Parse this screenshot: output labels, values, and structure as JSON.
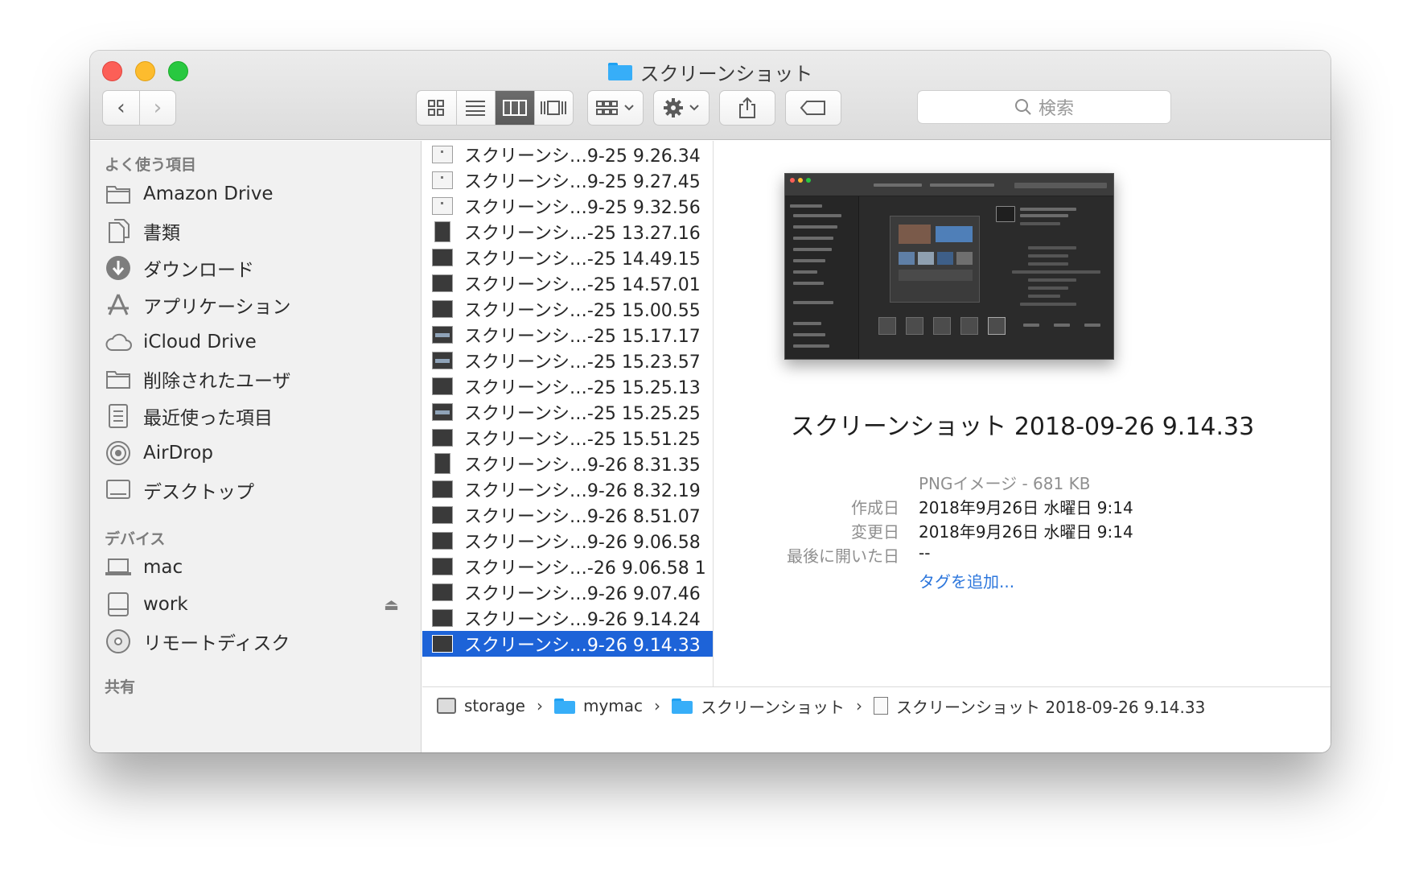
{
  "window": {
    "title": "スクリーンショット"
  },
  "toolbar": {
    "back": "‹",
    "forward": "›",
    "search_placeholder": "検索"
  },
  "sidebar": {
    "sections": {
      "favorites": "よく使う項目",
      "devices": "デバイス",
      "shared": "共有"
    },
    "favorites": [
      {
        "label": "Amazon Drive",
        "icon": "folder-icon"
      },
      {
        "label": "書類",
        "icon": "documents-icon"
      },
      {
        "label": "ダウンロード",
        "icon": "downloads-icon"
      },
      {
        "label": "アプリケーション",
        "icon": "applications-icon"
      },
      {
        "label": "iCloud Drive",
        "icon": "cloud-icon"
      },
      {
        "label": "削除されたユーザ",
        "icon": "folder-icon"
      },
      {
        "label": "最近使った項目",
        "icon": "recents-icon"
      },
      {
        "label": "AirDrop",
        "icon": "airdrop-icon"
      },
      {
        "label": "デスクトップ",
        "icon": "desktop-icon"
      }
    ],
    "devices": [
      {
        "label": "mac",
        "icon": "laptop-icon"
      },
      {
        "label": "work",
        "icon": "drive-icon",
        "eject": "⏏"
      },
      {
        "label": "リモートディスク",
        "icon": "disc-icon"
      }
    ]
  },
  "files": [
    {
      "name": "スクリーンシ…9-25 9.26.34",
      "thumb": "light"
    },
    {
      "name": "スクリーンシ…9-25 9.27.45",
      "thumb": "light"
    },
    {
      "name": "スクリーンシ…9-25 9.32.56",
      "thumb": "light"
    },
    {
      "name": "スクリーンシ…-25 13.27.16",
      "thumb": "tall"
    },
    {
      "name": "スクリーンシ…-25 14.49.15",
      "thumb": "dark"
    },
    {
      "name": "スクリーンシ…-25 14.57.01",
      "thumb": "dark"
    },
    {
      "name": "スクリーンシ…-25 15.00.55",
      "thumb": "dark"
    },
    {
      "name": "スクリーンシ…-25 15.17.17",
      "thumb": "bar"
    },
    {
      "name": "スクリーンシ…-25 15.23.57",
      "thumb": "bar"
    },
    {
      "name": "スクリーンシ…-25 15.25.13",
      "thumb": "dark"
    },
    {
      "name": "スクリーンシ…-25 15.25.25",
      "thumb": "bar"
    },
    {
      "name": "スクリーンシ…-25 15.51.25",
      "thumb": "dark"
    },
    {
      "name": "スクリーンシ…9-26 8.31.35",
      "thumb": "tall"
    },
    {
      "name": "スクリーンシ…9-26 8.32.19",
      "thumb": "dark"
    },
    {
      "name": "スクリーンシ…9-26 8.51.07",
      "thumb": "dark"
    },
    {
      "name": "スクリーンシ…9-26 9.06.58",
      "thumb": "dark"
    },
    {
      "name": "スクリーンシ…-26 9.06.58 1",
      "thumb": "dark"
    },
    {
      "name": "スクリーンシ…9-26 9.07.46",
      "thumb": "dark"
    },
    {
      "name": "スクリーンシ…9-26 9.14.24",
      "thumb": "dark"
    },
    {
      "name": "スクリーンシ…9-26 9.14.33",
      "thumb": "dark",
      "selected": true
    }
  ],
  "preview": {
    "file_name": "スクリーンショット 2018-09-26 9.14.33",
    "kind_size": "PNGイメージ - 681 KB",
    "created_label": "作成日",
    "created_value": "2018年9月26日 水曜日 9:14",
    "modified_label": "変更日",
    "modified_value": "2018年9月26日 水曜日 9:14",
    "last_opened_label": "最後に開いた日",
    "last_opened_value": "--",
    "add_tags": "タグを追加..."
  },
  "path": [
    {
      "label": "storage",
      "icon": "drive-icon"
    },
    {
      "label": "mymac",
      "icon": "folder-icon"
    },
    {
      "label": "スクリーンショット",
      "icon": "folder-icon"
    },
    {
      "label": "スクリーンショット 2018-09-26 9.14.33",
      "icon": "document-icon"
    }
  ],
  "colors": {
    "selection": "#1d63d8",
    "link": "#2c76dc",
    "folder": "#37aef8"
  }
}
